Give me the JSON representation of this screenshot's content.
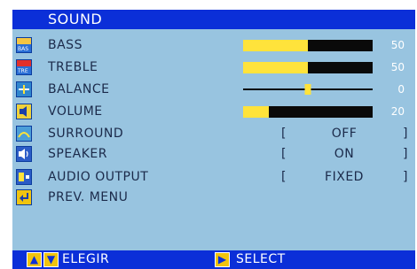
{
  "title": "SOUND",
  "colors": {
    "header": "#0b2fd8",
    "panel": "#98c4e0",
    "bar_fill": "#ffe33b",
    "bar_empty": "#0a0a0a"
  },
  "menu": {
    "bass": {
      "label": "BASS",
      "value": "50",
      "level": 0.5
    },
    "treble": {
      "label": "TREBLE",
      "value": "50",
      "level": 0.5
    },
    "balance": {
      "label": "BALANCE",
      "value": "0",
      "level": 0.5
    },
    "volume": {
      "label": "VOLUME",
      "value": "20",
      "level": 0.2
    },
    "surround": {
      "label": "SURROUND",
      "bracket_open": "[",
      "value": "OFF",
      "bracket_close": "]"
    },
    "speaker": {
      "label": "SPEAKER",
      "bracket_open": "[",
      "value": "ON",
      "bracket_close": "]"
    },
    "audio_output": {
      "label": "AUDIO OUTPUT",
      "bracket_open": "[",
      "value": "FIXED",
      "bracket_close": "]"
    },
    "prev_menu": {
      "label": "PREV. MENU"
    }
  },
  "icons": {
    "bass": "bass-icon",
    "treble": "treble-icon",
    "balance": "balance-icon",
    "volume": "volume-icon",
    "surround": "surround-icon",
    "speaker": "speaker-icon",
    "audio_output": "audio-output-icon",
    "prev_menu": "return-arrow-icon",
    "bass_tag": "BAS",
    "treble_tag": "TRE"
  },
  "footer": {
    "up_arrow": "▲",
    "down_arrow": "▼",
    "choose_label": "ELEGIR",
    "select_arrow": "▶",
    "select_label": "SELECT"
  }
}
